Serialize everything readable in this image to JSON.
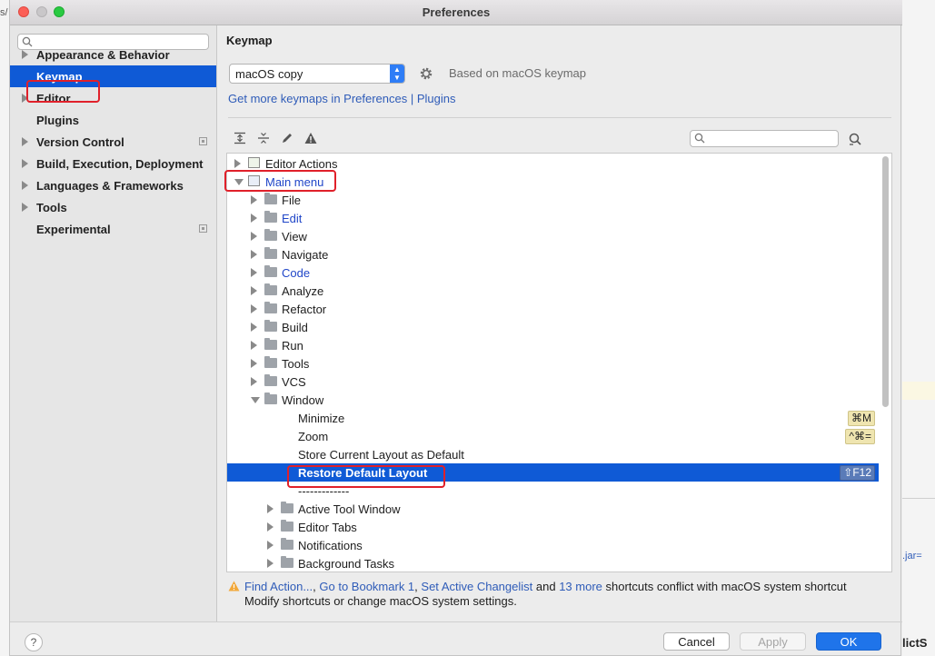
{
  "window": {
    "title": "Preferences"
  },
  "sidebar": {
    "search_placeholder": "",
    "items": [
      {
        "label": "Appearance & Behavior",
        "expandable": true
      },
      {
        "label": "Keymap",
        "expandable": false,
        "selected": true
      },
      {
        "label": "Editor",
        "expandable": true
      },
      {
        "label": "Plugins",
        "expandable": false
      },
      {
        "label": "Version Control",
        "expandable": true
      },
      {
        "label": "Build, Execution, Deployment",
        "expandable": true
      },
      {
        "label": "Languages & Frameworks",
        "expandable": true
      },
      {
        "label": "Tools",
        "expandable": true
      },
      {
        "label": "Experimental",
        "expandable": false
      }
    ]
  },
  "main": {
    "heading": "Keymap",
    "keymap_select": {
      "value": "macOS copy"
    },
    "based_on": "Based on macOS keymap",
    "get_more_link": "Get more keymaps in Preferences | Plugins",
    "filter_placeholder": ""
  },
  "tree": {
    "rows": [
      {
        "label": "Editor Actions",
        "arrow": "right",
        "level": 0,
        "icon": "editor-actions-icon"
      },
      {
        "label": "Main menu",
        "arrow": "down",
        "level": 0,
        "icon": "main-menu-icon",
        "blue": true
      },
      {
        "label": "File",
        "arrow": "right",
        "level": 1,
        "icon": "folder-icon"
      },
      {
        "label": "Edit",
        "arrow": "right",
        "level": 1,
        "icon": "folder-icon",
        "blue": true
      },
      {
        "label": "View",
        "arrow": "right",
        "level": 1,
        "icon": "folder-icon"
      },
      {
        "label": "Navigate",
        "arrow": "right",
        "level": 1,
        "icon": "folder-icon"
      },
      {
        "label": "Code",
        "arrow": "right",
        "level": 1,
        "icon": "folder-icon",
        "blue": true
      },
      {
        "label": "Analyze",
        "arrow": "right",
        "level": 1,
        "icon": "folder-icon"
      },
      {
        "label": "Refactor",
        "arrow": "right",
        "level": 1,
        "icon": "folder-icon"
      },
      {
        "label": "Build",
        "arrow": "right",
        "level": 1,
        "icon": "folder-icon"
      },
      {
        "label": "Run",
        "arrow": "right",
        "level": 1,
        "icon": "folder-icon"
      },
      {
        "label": "Tools",
        "arrow": "right",
        "level": 1,
        "icon": "folder-icon"
      },
      {
        "label": "VCS",
        "arrow": "right",
        "level": 1,
        "icon": "folder-icon"
      },
      {
        "label": "Window",
        "arrow": "down",
        "level": 1,
        "icon": "folder-icon"
      },
      {
        "label": "Minimize",
        "level": 2,
        "shortcut": "⌘M"
      },
      {
        "label": "Zoom",
        "level": 2,
        "shortcut": "^⌘="
      },
      {
        "label": "Store Current Layout as Default",
        "level": 2
      },
      {
        "label": "Restore Default Layout",
        "level": 2,
        "shortcut": "⇧F12",
        "selected": true
      },
      {
        "label": "-------------",
        "level": 2
      },
      {
        "label": "Active Tool Window",
        "arrow": "right",
        "level": 2,
        "icon": "folder-icon"
      },
      {
        "label": "Editor Tabs",
        "arrow": "right",
        "level": 2,
        "icon": "folder-icon"
      },
      {
        "label": "Notifications",
        "arrow": "right",
        "level": 2,
        "icon": "folder-icon"
      },
      {
        "label": "Background Tasks",
        "arrow": "right",
        "level": 2,
        "icon": "folder-icon"
      }
    ]
  },
  "conflict": {
    "link1": "Find Action...",
    "sep1": ", ",
    "link2": "Go to Bookmark 1",
    "sep2": ", ",
    "link3": "Set Active Changelist",
    "and": " and ",
    "link4": "13 more",
    "rest": " shortcuts conflict with macOS system shortcut",
    "line2": "Modify shortcuts or change macOS system settings."
  },
  "buttons": {
    "help": "?",
    "cancel": "Cancel",
    "apply": "Apply",
    "ok": "OK"
  },
  "background": {
    "frag_top": "s/",
    "frag_bottom_right": "lictS",
    "frag_jar": ".jar="
  },
  "colors": {
    "accent": "#0f5ad6",
    "highlight_box": "#e0202a",
    "link": "#2f5cb8"
  }
}
